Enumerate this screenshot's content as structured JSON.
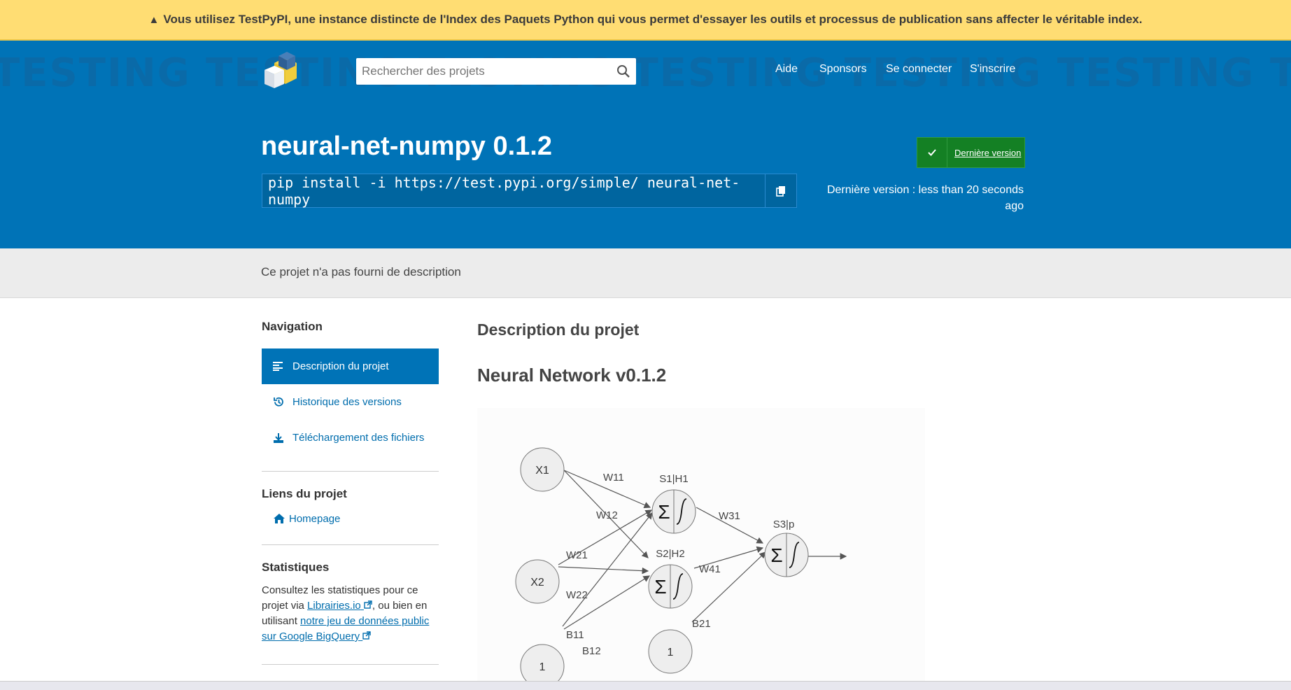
{
  "banner": {
    "warning_icon": "warning-icon",
    "text": "Vous utilisez TestPyPI, une instance distincte de l'Index des Paquets Python qui vous permet d'essayer les outils et processus de publication sans affecter le véritable index."
  },
  "header": {
    "watermark": "TESTING TESTING TESTING TESTING TESTING TESTING TESTING TESTING TESTING TESTING",
    "search_placeholder": "Rechercher des projets",
    "nav": [
      "Aide",
      "Sponsors",
      "Se connecter",
      "S'inscrire"
    ]
  },
  "hero": {
    "title": "neural-net-numpy 0.1.2",
    "pip_command": "pip install -i https://test.pypi.org/simple/ neural-net-numpy",
    "latest_button": "Dernière version",
    "release_text": "Dernière version : less than 20 seconds ago"
  },
  "summary": "Ce projet n'a pas fourni de description",
  "sidebar": {
    "navigation_heading": "Navigation",
    "nav_items": [
      "Description du projet",
      "Historique des versions",
      "Téléchargement des fichiers"
    ],
    "links_heading": "Liens du projet",
    "homepage": "Homepage",
    "stats_heading": "Statistiques",
    "stats_pre": "Consultez les statistiques pour ce projet via ",
    "stats_link1": "Librairies.io",
    "stats_mid": ", ou bien en utilisant ",
    "stats_link2": "notre jeu de données public sur Google BigQuery"
  },
  "content": {
    "heading": "Description du projet",
    "subheading": "Neural Network v0.1.2",
    "diagram": {
      "nodes": [
        "X1",
        "X2",
        "1",
        "1"
      ],
      "neuron_labels": [
        "S1|H1",
        "S2|H2",
        "S3|p"
      ],
      "weights": [
        "W11",
        "W12",
        "W21",
        "W22",
        "B11",
        "B12",
        "W31",
        "W41",
        "B21"
      ]
    }
  },
  "colors": {
    "banner": "#ffdd73",
    "header": "#0073b7",
    "latest_button": "#148024",
    "link": "#006dad"
  }
}
